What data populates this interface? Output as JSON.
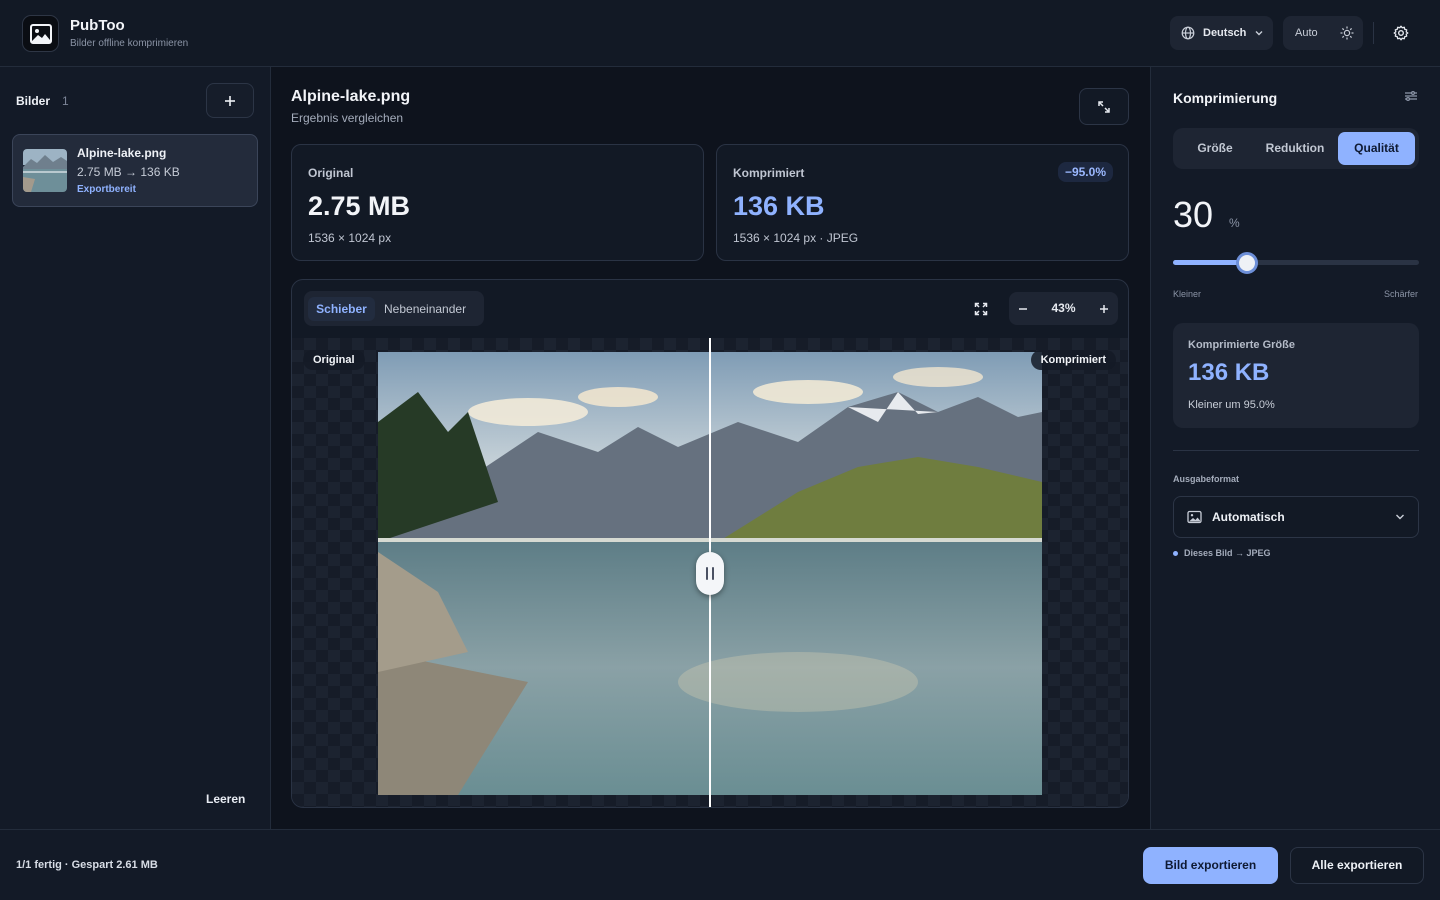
{
  "app": {
    "title": "PubToo",
    "subtitle": "Bilder offline komprimieren"
  },
  "header": {
    "language": "Deutsch",
    "theme": "Auto",
    "icons": [
      "globe-icon",
      "chevron-down-icon",
      "sun-icon",
      "gear-icon"
    ]
  },
  "sidebar": {
    "title": "Bilder",
    "count": "1",
    "files": [
      {
        "name": "Alpine-lake.png",
        "sizes": "2.75 MB → 136 KB",
        "status": "Exportbereit"
      }
    ],
    "clear_label": "Leeren"
  },
  "main": {
    "title": "Alpine-lake.png",
    "subtitle": "Ergebnis vergleichen",
    "original": {
      "label": "Original",
      "size": "2.75 MB",
      "dims": "1536 × 1024 px"
    },
    "compressed": {
      "label": "Komprimiert",
      "size": "136 KB",
      "dims": "1536 × 1024 px · JPEG",
      "badge": "−95.0%"
    },
    "compare": {
      "modes": [
        "Schieber",
        "Nebeneinander"
      ],
      "active_mode": "Schieber",
      "zoom": "43%",
      "left_label": "Original",
      "right_label": "Komprimiert",
      "divider_position": 0.5
    }
  },
  "panel": {
    "title": "Komprimierung",
    "tabs": [
      "Größe",
      "Reduktion",
      "Qualität"
    ],
    "active_tab": "Qualität",
    "quality_value": "30",
    "quality_unit": "%",
    "slider_fraction": 0.3,
    "slider_min_label": "Kleiner",
    "slider_max_label": "Schärfer",
    "result": {
      "label": "Komprimierte Größe",
      "value": "136 KB",
      "note": "Kleiner um 95.0%"
    },
    "format_label": "Ausgabeformat",
    "format_value": "Automatisch",
    "format_hint": "Dieses Bild → JPEG"
  },
  "footer": {
    "status": "1/1 fertig · Gespart 2.61 MB",
    "export_label": "Bild exportieren",
    "export_all_label": "Alle exportieren"
  },
  "colors": {
    "accent": "#8fb2ff",
    "background": "#131a27",
    "main_bg": "#0e131d"
  }
}
